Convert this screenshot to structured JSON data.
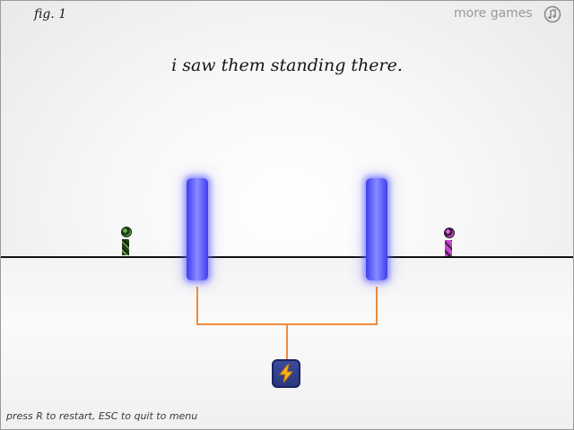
{
  "header": {
    "figure_label": "fig. 1",
    "more_games_label": "more games",
    "music_icon": "music-note-icon"
  },
  "scene": {
    "narration": "i saw them standing there.",
    "characters": [
      {
        "name": "green-figure",
        "color": "#4f8a3a"
      },
      {
        "name": "pink-figure",
        "color": "#d24bd2"
      }
    ],
    "portal_color": "#5a5aff",
    "wire_color": "#f08a3a",
    "switch_icon": "lightning-bolt-icon"
  },
  "footer": {
    "hint": "press R to restart, ESC to quit to menu"
  }
}
